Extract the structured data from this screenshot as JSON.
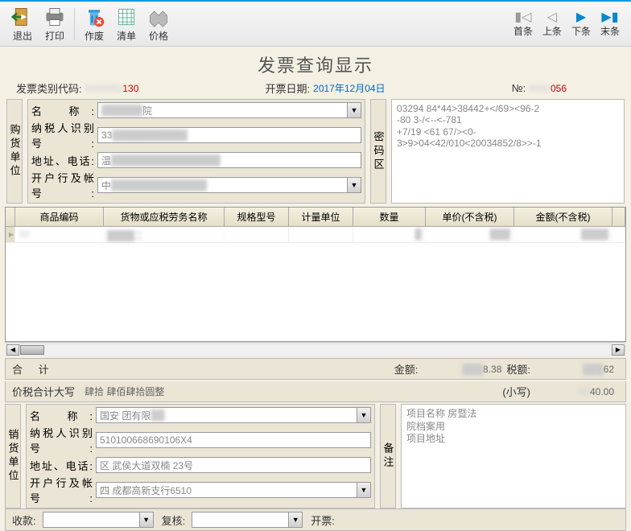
{
  "toolbar": {
    "exit": "退出",
    "print": "打印",
    "void": "作废",
    "list": "清单",
    "price": "价格",
    "first": "首条",
    "prev": "上条",
    "next": "下条",
    "last": "末条"
  },
  "title": "发票查询显示",
  "header": {
    "type_label": "发票类别代码:",
    "type_value": "130",
    "date_label": "开票日期:",
    "date_value": "2017年12月04日",
    "no_label": "№:",
    "no_value": "056"
  },
  "buyer": {
    "section": "购货单位",
    "name_lbl": "名    称",
    "name_val": "院",
    "tax_lbl": "纳税人识别号",
    "tax_val": "33",
    "addr_lbl": "地址、电话",
    "addr_val": "温",
    "bank_lbl": "开户行及帐号",
    "bank_val": "中"
  },
  "cipher": {
    "section": "密码区",
    "line1": "03294 84*44>38442+</69><96-2",
    "line2": "-80              3-/<--<-781",
    "line3": "+7/19        <61 67/><0-",
    "line4": "3>9>04<42/010<20034852/8>>-1"
  },
  "grid": {
    "cols": [
      "商品编码",
      "货物或应税劳务名称",
      "规格型号",
      "计量单位",
      "数量",
      "单价(不含税)",
      "金额(不含税)"
    ],
    "row0": [
      "",
      "",
      "",
      "",
      "",
      "",
      ""
    ]
  },
  "totals": {
    "heji": "合    计",
    "amt_lbl": "金额:",
    "amt_val": "8.38",
    "tax_lbl": "税额:",
    "tax_val": "62",
    "dx_lbl": "价税合计大写",
    "dx_val": "肆拾   肆佰肆拾圆整",
    "xx_lbl": "(小写)",
    "xx_val": "40.00"
  },
  "seller": {
    "section": "销货单位",
    "name_lbl": "名    称",
    "name_val": "国安      团有限",
    "tax_lbl": "纳税人识别号",
    "tax_val": "510100668690106X4",
    "addr_lbl": "地址、电话",
    "addr_val": "区 武侯大道双楠    23号",
    "bank_lbl": "开户行及帐号",
    "bank_val": "四        成都高新支行6510"
  },
  "remarks": {
    "section": "备注",
    "line1": "项目名称                    房暨法",
    "line2": "院档案用",
    "line3": "项目地址"
  },
  "footer": {
    "sk_lbl": "收款:",
    "sk_val": "",
    "fh_lbl": "复核:",
    "fh_val": "",
    "kp_lbl": "开票:",
    "kp_val": ""
  }
}
